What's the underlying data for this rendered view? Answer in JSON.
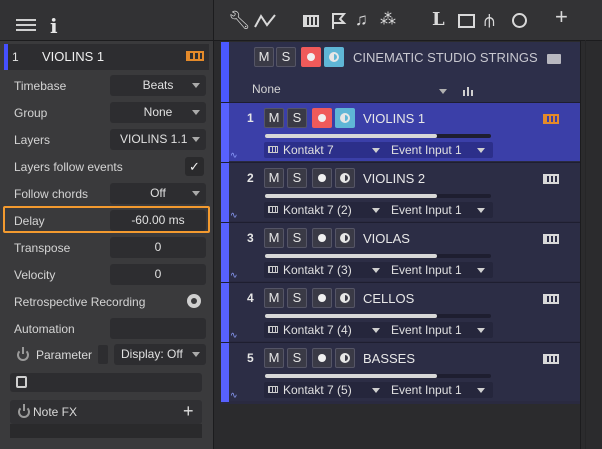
{
  "inspector": {
    "track_number": "1",
    "track_name": "VIOLINS 1",
    "rows": [
      {
        "label": "Timebase",
        "value": "Beats"
      },
      {
        "label": "Group",
        "value": "None"
      },
      {
        "label": "Layers",
        "value": "VIOLINS 1.1"
      },
      {
        "label": "Layers follow events",
        "value": "✓"
      },
      {
        "label": "Follow chords",
        "value": "Off"
      },
      {
        "label": "Delay",
        "value": "-60.00 ms"
      },
      {
        "label": "Transpose",
        "value": "0"
      },
      {
        "label": "Velocity",
        "value": "0"
      },
      {
        "label": "Retrospective Recording",
        "value": ""
      },
      {
        "label": "Automation",
        "value": ""
      }
    ],
    "parameter_label": "Parameter",
    "display_value": "Display: Off",
    "note_fx_label": "Note FX",
    "add_glyph": "+"
  },
  "toolbar": {
    "icons": [
      "wrench-icon",
      "curve-icon",
      "keyboard-icon",
      "flag-icon",
      "score-icon",
      "grid-icon",
      "L",
      "film-icon",
      "split-icon",
      "clock-icon",
      "+"
    ]
  },
  "folder": {
    "mute": "M",
    "solo": "S",
    "title": "CINEMATIC STUDIO STRINGS",
    "filter_value": "None"
  },
  "tracks": [
    {
      "num": "1",
      "name": "VIOLINS 1",
      "instrument": "Kontakt 7",
      "input": "Event Input 1",
      "volume": 0.76,
      "selected": true,
      "rec": true,
      "monitor": true
    },
    {
      "num": "2",
      "name": "VIOLINS 2",
      "instrument": "Kontakt 7 (2)",
      "input": "Event Input 1",
      "volume": 0.76,
      "selected": false,
      "rec": false,
      "monitor": false
    },
    {
      "num": "3",
      "name": "VIOLAS",
      "instrument": "Kontakt 7 (3)",
      "input": "Event Input 1",
      "volume": 0.76,
      "selected": false,
      "rec": false,
      "monitor": false
    },
    {
      "num": "4",
      "name": "CELLOS",
      "instrument": "Kontakt 7 (4)",
      "input": "Event Input 1",
      "volume": 0.76,
      "selected": false,
      "rec": false,
      "monitor": false
    },
    {
      "num": "5",
      "name": "BASSES",
      "instrument": "Kontakt 7 (5)",
      "input": "Event Input 1",
      "volume": 0.76,
      "selected": false,
      "rec": false,
      "monitor": false
    }
  ],
  "button_labels": {
    "mute": "M",
    "solo": "S"
  },
  "colors": {
    "accent_blue": "#4a58ff",
    "highlight_orange": "#f39a2f",
    "record_red": "#f05a5a",
    "monitor_cyan": "#5fb6d6"
  }
}
